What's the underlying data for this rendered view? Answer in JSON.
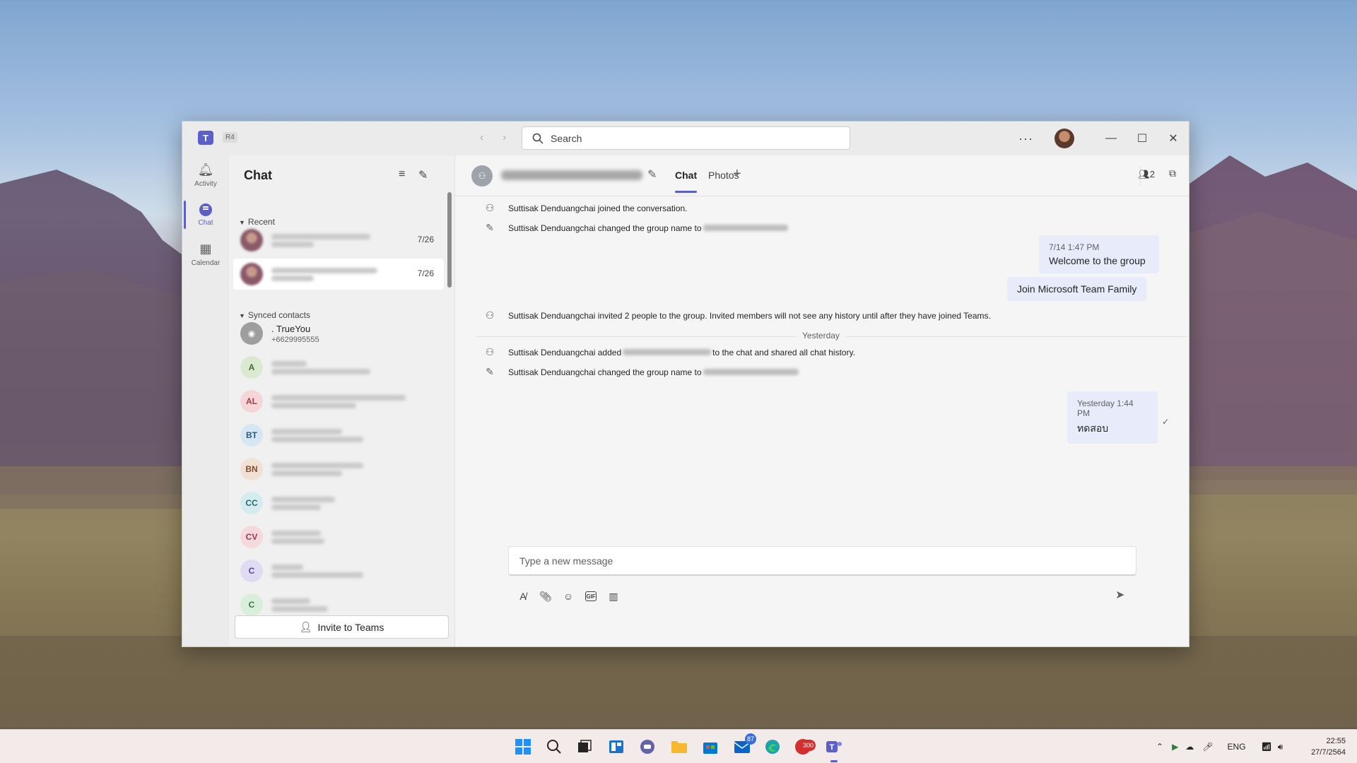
{
  "window": {
    "badge": "R4",
    "search_placeholder": "Search"
  },
  "rail": {
    "items": [
      {
        "label": "Activity"
      },
      {
        "label": "Chat"
      },
      {
        "label": "Calendar"
      }
    ]
  },
  "chat_list": {
    "title": "Chat",
    "recent_label": "Recent",
    "recent": [
      {
        "date": "7/26"
      },
      {
        "date": "7/26"
      }
    ],
    "synced_label": "Synced contacts",
    "synced": [
      {
        "name": ". TrueYou",
        "sub": "+6629995555",
        "initials": ""
      },
      {
        "initials": "A",
        "color": "#dbe9d2",
        "text_color": "#3d6b2a"
      },
      {
        "initials": "AL",
        "color": "#f5d5d8",
        "text_color": "#a43c4a"
      },
      {
        "initials": "BT",
        "color": "#d6e6f2",
        "text_color": "#2c5a7f"
      },
      {
        "initials": "BN",
        "color": "#f1e0d4",
        "text_color": "#8a4b2a"
      },
      {
        "initials": "CC",
        "color": "#d4ecef",
        "text_color": "#2a6a73"
      },
      {
        "initials": "CV",
        "color": "#f6d9dd",
        "text_color": "#9a3a4a"
      },
      {
        "initials": "C",
        "color": "#e0dbf2",
        "text_color": "#5147a0"
      },
      {
        "initials": "C",
        "color": "#d9efdc",
        "text_color": "#2f7a3f"
      }
    ],
    "invite_label": "Invite to Teams"
  },
  "chat": {
    "tabs": [
      "Chat",
      "Photos"
    ],
    "people_count": "2",
    "events": [
      {
        "text": "Suttisak Denduangchai joined the conversation."
      },
      {
        "text": "Suttisak Denduangchai changed the group name to"
      },
      {
        "text": "Suttisak Denduangchai invited 2 people to the group. Invited members will not see any history until after they have joined Teams."
      },
      {
        "text_a": "Suttisak Denduangchai added",
        "text_b": "to the chat and shared all chat history."
      },
      {
        "text": "Suttisak Denduangchai changed the group name to"
      }
    ],
    "messages": [
      {
        "time": "7/14 1:47 PM",
        "text": "Welcome to the group"
      },
      {
        "text": "Join Microsoft Team Family"
      },
      {
        "time": "Yesterday 1:44 PM",
        "text": "ทดสอบ"
      }
    ],
    "day_label": "Yesterday",
    "compose_placeholder": "Type a new message"
  },
  "taskbar": {
    "badges": [
      "87",
      "300"
    ],
    "lang": "ENG",
    "time": "22:55",
    "date": "27/7/2564"
  },
  "colors": {
    "accent": "#5b5fc7",
    "bubble": "#e8ebfa"
  }
}
